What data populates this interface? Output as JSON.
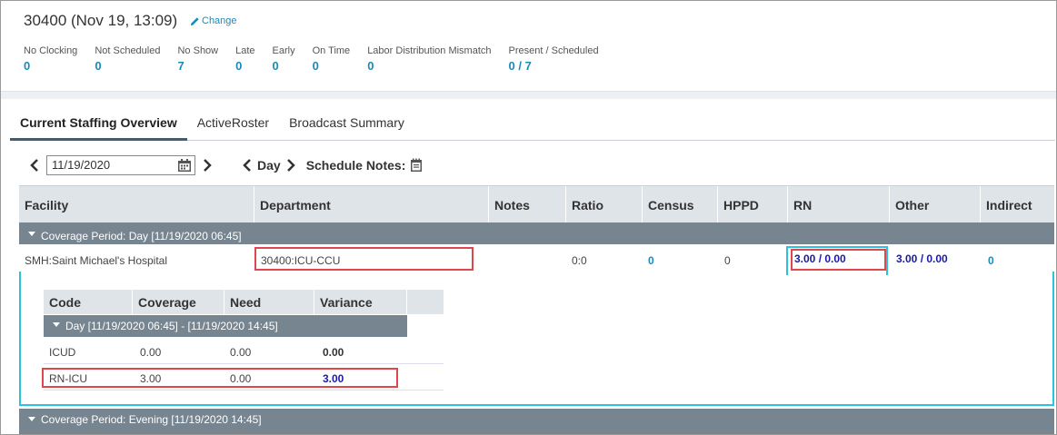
{
  "header": {
    "title": "30400 (Nov 19, 13:09)",
    "change_label": "Change",
    "stats": [
      {
        "label": "No Clocking",
        "value": "0"
      },
      {
        "label": "Not Scheduled",
        "value": "0"
      },
      {
        "label": "No Show",
        "value": "7"
      },
      {
        "label": "Late",
        "value": "0"
      },
      {
        "label": "Early",
        "value": "0"
      },
      {
        "label": "On Time",
        "value": "0"
      },
      {
        "label": "Labor Distribution Mismatch",
        "value": "0"
      },
      {
        "label": "Present / Scheduled",
        "value": "0 / 7"
      }
    ]
  },
  "tabs": [
    "Current Staffing Overview",
    "ActiveRoster",
    "Broadcast Summary"
  ],
  "toolbar": {
    "date_value": "11/19/2020",
    "period_label": "Day",
    "schedule_notes_label": "Schedule Notes:"
  },
  "grid": {
    "columns": [
      "Facility",
      "Department",
      "Notes",
      "Ratio",
      "Census",
      "HPPD",
      "RN",
      "Other",
      "Indirect"
    ],
    "period_day": "Coverage Period: Day [11/19/2020 06:45]",
    "period_evening": "Coverage Period: Evening [11/19/2020 14:45]",
    "row": {
      "facility": "SMH:Saint Michael's Hospital",
      "department": "30400:ICU-CCU",
      "notes": "",
      "ratio": "0:0",
      "census": "0",
      "hppd": "0",
      "rn": "3.00 / 0.00",
      "other": "3.00 / 0.00",
      "indirect": "0"
    }
  },
  "subtable": {
    "columns": [
      "Code",
      "Coverage",
      "Need",
      "Variance"
    ],
    "period": "Day [11/19/2020 06:45] - [11/19/2020 14:45]",
    "rows": [
      {
        "code": "ICUD",
        "coverage": "0.00",
        "need": "0.00",
        "variance": "0.00"
      },
      {
        "code": "RN-ICU",
        "coverage": "3.00",
        "need": "0.00",
        "variance": "3.00"
      }
    ]
  },
  "colors": {
    "accent": "#1a8bb8",
    "highlight_red": "#e0464e",
    "highlight_cyan": "#28c3de",
    "period_bar": "#76858f"
  }
}
